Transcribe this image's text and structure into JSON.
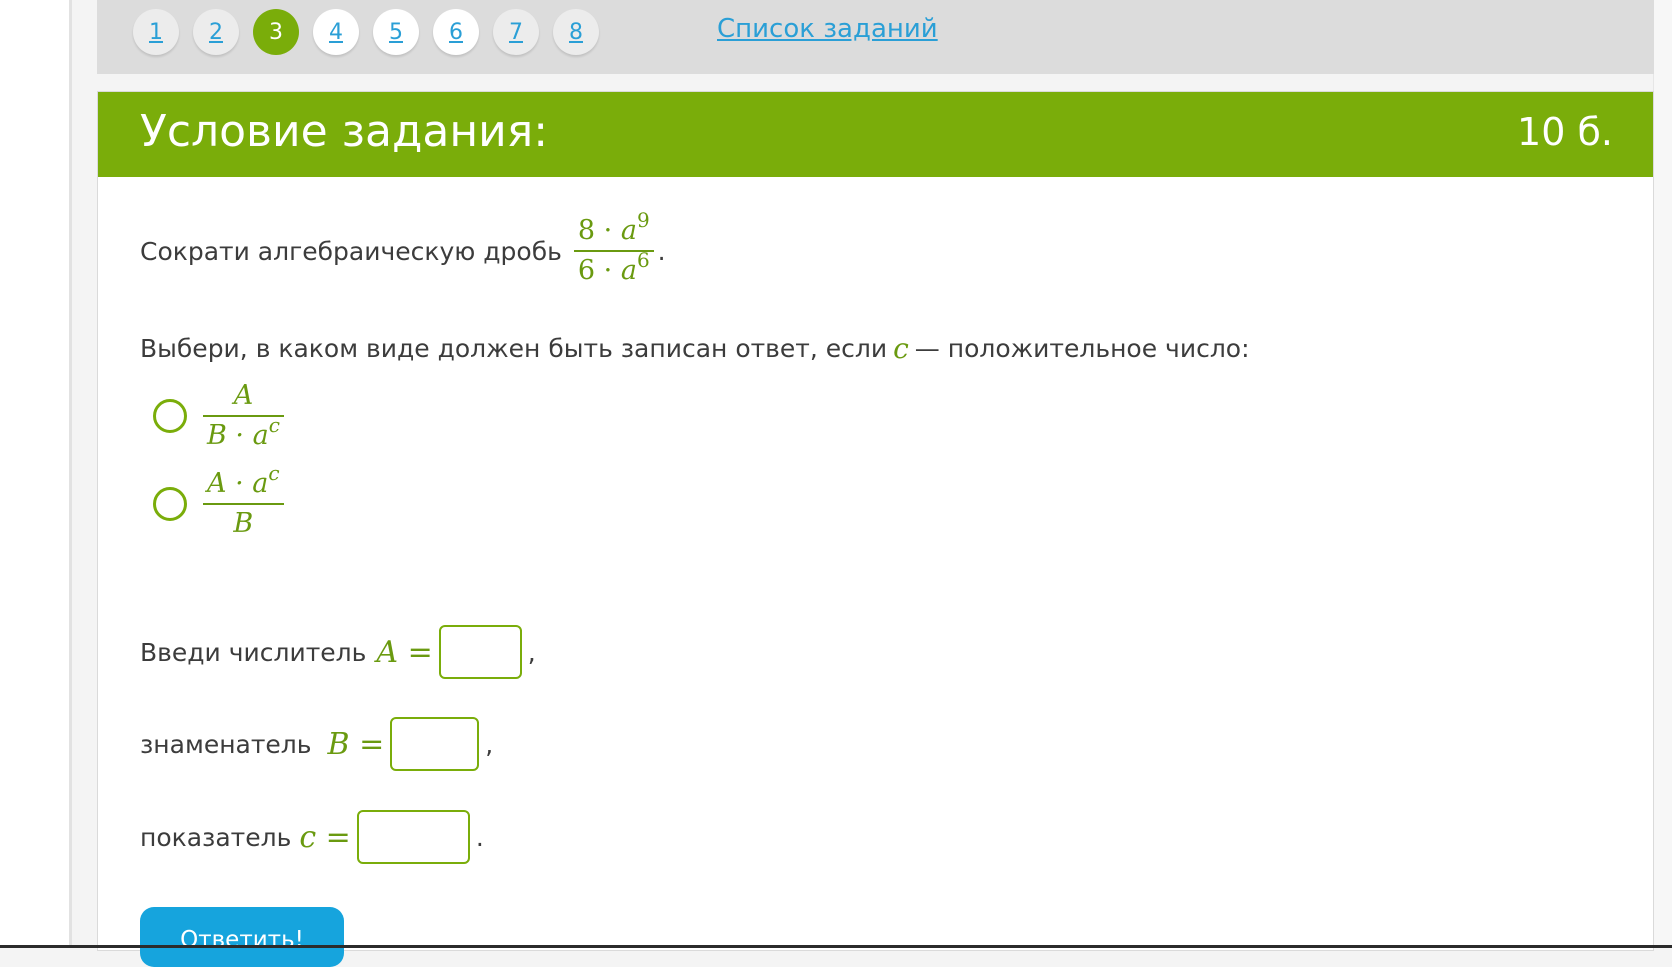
{
  "nav": {
    "pages": [
      "1",
      "2",
      "3",
      "4",
      "5",
      "6",
      "7",
      "8"
    ],
    "active": "3",
    "task_list": "Список заданий"
  },
  "task": {
    "header_title": "Условие задания:",
    "points": "10 б.",
    "instruction": "Сократи алгебраическую дробь",
    "fraction": {
      "num_coef": "8",
      "num_exp": "9",
      "den_coef": "6",
      "den_exp": "6",
      "var": "a",
      "dot": "·"
    },
    "question_before": "Выбери, в каком виде должен быть записан ответ, если",
    "question_var": "c",
    "question_after": "— положительное число:",
    "options": [
      {
        "num": "A",
        "den": "B · a",
        "sup_den": "c",
        "sup_num": ""
      },
      {
        "num": "A · a",
        "den": "B",
        "sup_num": "c",
        "sup_den": ""
      }
    ],
    "numerator_label": "Введи числитель",
    "numerator_var": "A =",
    "numerator_value": "",
    "denominator_label": "знаменатель",
    "denominator_var": "B =",
    "denominator_value": "",
    "exponent_label": "показатель",
    "exponent_var": "c =",
    "exponent_value": "",
    "submit": "Ответить!"
  },
  "colors": {
    "accent": "#7aad0a",
    "link": "#2a9fd6",
    "button": "#16a4dd"
  }
}
